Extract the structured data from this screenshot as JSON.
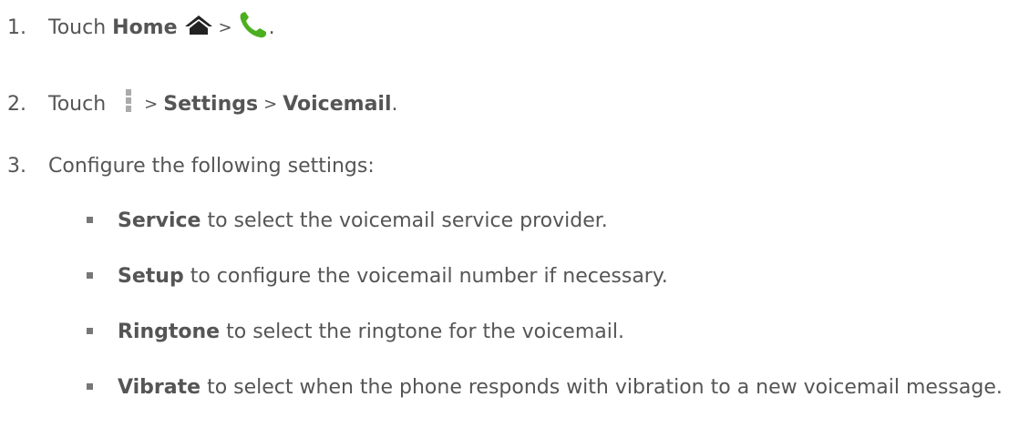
{
  "steps": [
    {
      "number": "1.",
      "text_before": "Touch",
      "bold1": "Home",
      "sep1": ">",
      "end": "."
    },
    {
      "number": "2.",
      "text_before": "Touch",
      "sep1": ">",
      "bold1": "Settings",
      "sep2": ">",
      "bold2": "Voicemail",
      "end": "."
    },
    {
      "number": "3.",
      "text": "Configure the following settings:"
    }
  ],
  "settings": [
    {
      "term": "Service",
      "description": "to select the voicemail service provider."
    },
    {
      "term": "Setup",
      "description": "to configure the voicemail number if necessary."
    },
    {
      "term": "Ringtone",
      "description": "to select the ringtone for the voicemail."
    },
    {
      "term": "Vibrate",
      "description": "to select when the phone responds with vibration to a new voicemail message."
    }
  ],
  "icons": {
    "home": "home-icon",
    "phone": "phone-icon",
    "menu": "menu-icon"
  },
  "colors": {
    "text": "#555555",
    "phone_green": "#4caf1f",
    "home_dark": "#222222",
    "menu_gray": "#aaaaaa"
  }
}
